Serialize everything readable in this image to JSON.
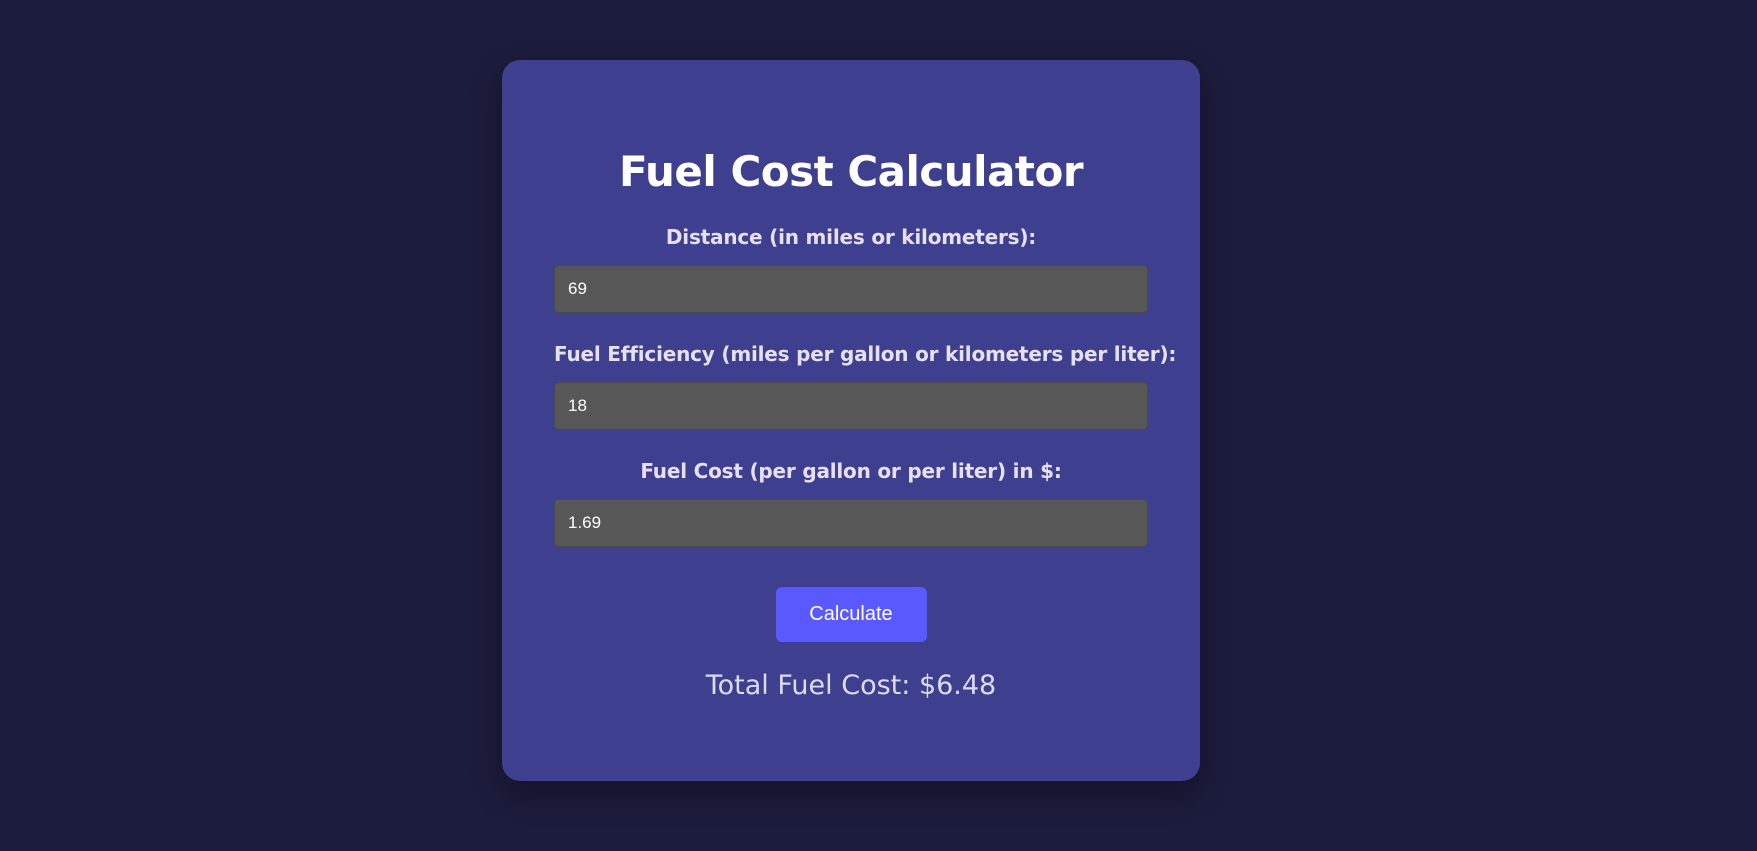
{
  "title": "Fuel Cost Calculator",
  "fields": [
    {
      "label": "Distance (in miles or kilometers):",
      "value": "69"
    },
    {
      "label": "Fuel Efficiency (miles per gallon or kilometers per liter):",
      "value": "18"
    },
    {
      "label": "Fuel Cost (per gallon or per liter) in $:",
      "value": "1.69"
    }
  ],
  "calculate_label": "Calculate",
  "result_text": "Total Fuel Cost: $6.48",
  "colors": {
    "background": "#1c1c3c",
    "card": "#3f3f8f",
    "input": "#575757",
    "button": "#5a58ff"
  }
}
